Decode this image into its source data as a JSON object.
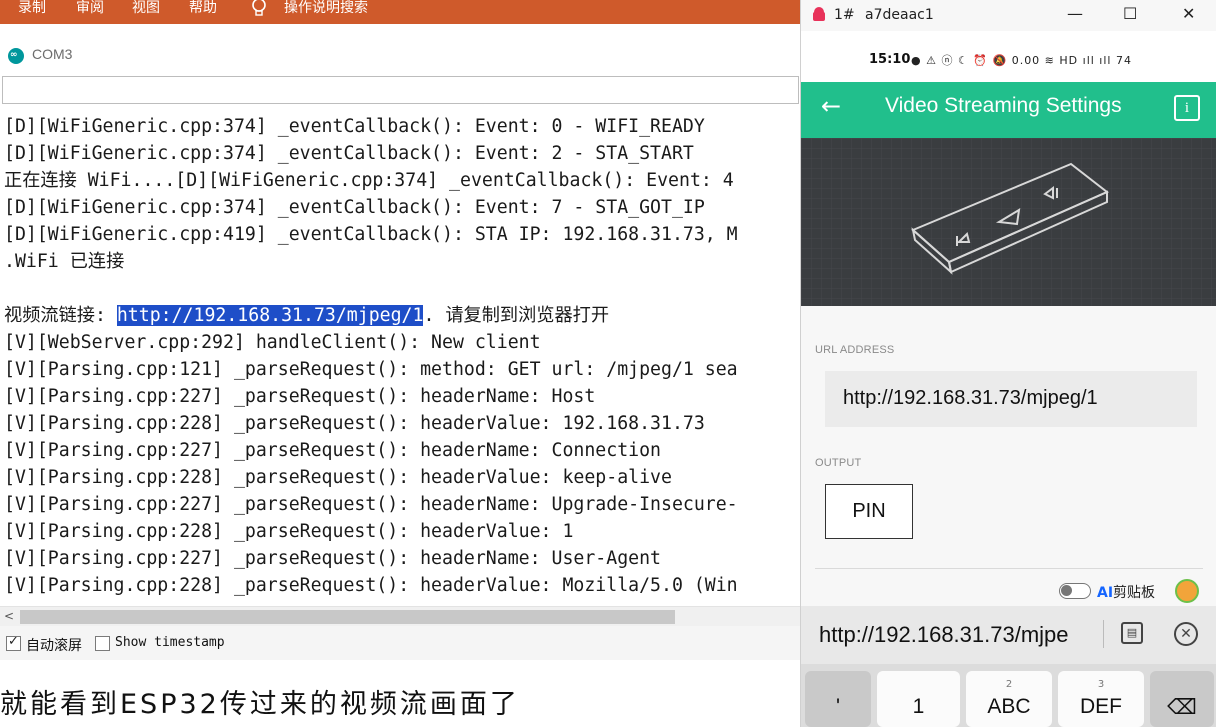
{
  "menubar": {
    "items": [
      "录制",
      "审阅",
      "视图",
      "帮助"
    ],
    "search_label": "操作说明搜索"
  },
  "serial_monitor": {
    "window_title": "COM3",
    "send_input_value": "",
    "lines": [
      "[D][WiFiGeneric.cpp:374] _eventCallback(): Event: 0 - WIFI_READY",
      "[D][WiFiGeneric.cpp:374] _eventCallback(): Event: 2 - STA_START",
      "正在连接 WiFi....[D][WiFiGeneric.cpp:374] _eventCallback(): Event: 4",
      "[D][WiFiGeneric.cpp:374] _eventCallback(): Event: 7 - STA_GOT_IP",
      "[D][WiFiGeneric.cpp:419] _eventCallback(): STA IP: 192.168.31.73, M",
      ".WiFi 已连接",
      "",
      "",
      "[V][WebServer.cpp:292] handleClient(): New client",
      "[V][Parsing.cpp:121] _parseRequest(): method: GET url: /mjpeg/1 sea",
      "[V][Parsing.cpp:227] _parseRequest(): headerName: Host",
      "[V][Parsing.cpp:228] _parseRequest(): headerValue: 192.168.31.73",
      "[V][Parsing.cpp:227] _parseRequest(): headerName: Connection",
      "[V][Parsing.cpp:228] _parseRequest(): headerValue: keep-alive",
      "[V][Parsing.cpp:227] _parseRequest(): headerName: Upgrade-Insecure-",
      "[V][Parsing.cpp:228] _parseRequest(): headerValue: 1",
      "[V][Parsing.cpp:227] _parseRequest(): headerName: User-Agent",
      "[V][Parsing.cpp:228] _parseRequest(): headerValue: Mozilla/5.0 (Win"
    ],
    "link_line": {
      "prefix": "视频流链接: ",
      "url": "http://192.168.31.73/mjpeg/1",
      "suffix": ". 请复制到浏览器打开"
    },
    "autoscroll_label": "自动滚屏",
    "autoscroll_checked": true,
    "timestamp_label": "Show timestamp",
    "timestamp_checked": false
  },
  "subtitle": "就能看到ESP32传过来的视频流画面了",
  "mirror_window": {
    "device_index": "1#",
    "device_id": "a7deaac1",
    "controls": [
      "—",
      "☐",
      "✕"
    ]
  },
  "phone": {
    "status_time": "15:10",
    "status_icons": "● ⚠ ⓝ ☾ ⏰ 🔕 0.00 ≋ HD ıll ıll 74",
    "appbar_title": "Video Streaming Settings",
    "info_label": "i",
    "url_section_label": "URL ADDRESS",
    "url_value": "http://192.168.31.73/mjpeg/1",
    "output_section_label": "OUTPUT",
    "pin_button_label": "PIN",
    "clipboard_label": "剪贴板",
    "clipboard_ai": "AI",
    "suggestion_text": "http://192.168.31.73/mjpe",
    "keyboard": {
      "keys": [
        {
          "sup": "",
          "main": "'"
        },
        {
          "sup": "",
          "main": "1"
        },
        {
          "sup": "2",
          "main": "ABC"
        },
        {
          "sup": "3",
          "main": "DEF"
        },
        {
          "sup": "",
          "main": "⌫"
        }
      ]
    },
    "colors": {
      "appbar": "#21bf8c",
      "hero_bg": "#3a3d40",
      "highlight": "#1e4ec8"
    }
  }
}
